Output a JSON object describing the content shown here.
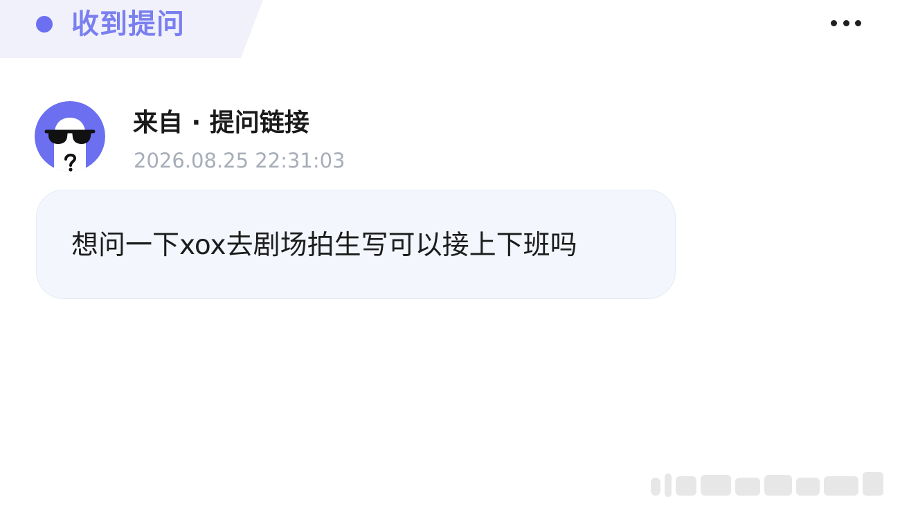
{
  "header": {
    "title": "收到提问",
    "accent_color": "#6b6ff0",
    "tab_background": "#f1f1fb"
  },
  "menu": {
    "icon": "more-horizontal-icon"
  },
  "message": {
    "avatar_icon": "anonymous-sunglasses-avatar",
    "avatar_color": "#6b6ff0",
    "sender": "来自 · 提问链接",
    "timestamp": "2026.08.25 22:31:03",
    "question": "想问一下xox去剧场拍生写可以接上下班吗"
  },
  "colors": {
    "sender_text": "#1a1a1a",
    "timestamp_text": "#a6adb8",
    "bubble_background": "#f3f7fd"
  }
}
